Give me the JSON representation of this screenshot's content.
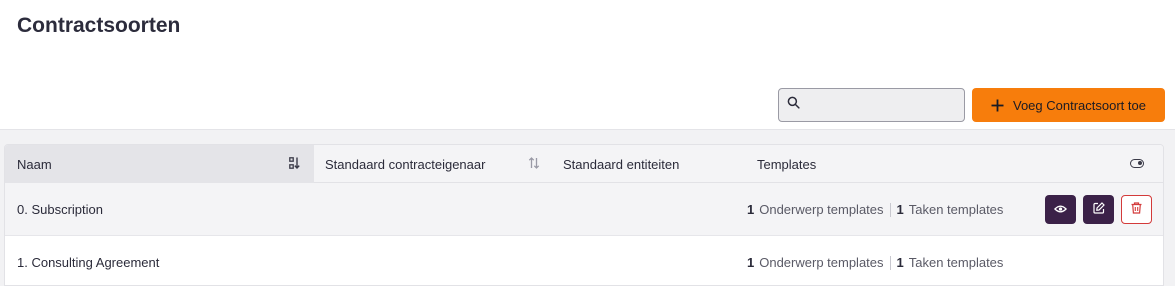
{
  "page": {
    "title": "Contractsoorten"
  },
  "toolbar": {
    "search_value": "",
    "add_label": "Voeg Contractsoort toe",
    "add_icon": "plus-icon",
    "search_icon": "search-icon"
  },
  "table": {
    "headers": {
      "name": "Naam",
      "owner": "Standaard contracteigenaar",
      "entities": "Standaard entiteiten",
      "templates": "Templates"
    },
    "rows": [
      {
        "name": "0. Subscription",
        "subject_count": "1",
        "subject_label": "Onderwerp templates",
        "task_count": "1",
        "task_label": "Taken templates"
      },
      {
        "name": "1. Consulting Agreement",
        "subject_count": "1",
        "subject_label": "Onderwerp templates",
        "task_count": "1",
        "task_label": "Taken templates"
      }
    ]
  },
  "colors": {
    "accent": "#f77d0c",
    "action": "#3b2148",
    "danger": "#d33a3a"
  }
}
